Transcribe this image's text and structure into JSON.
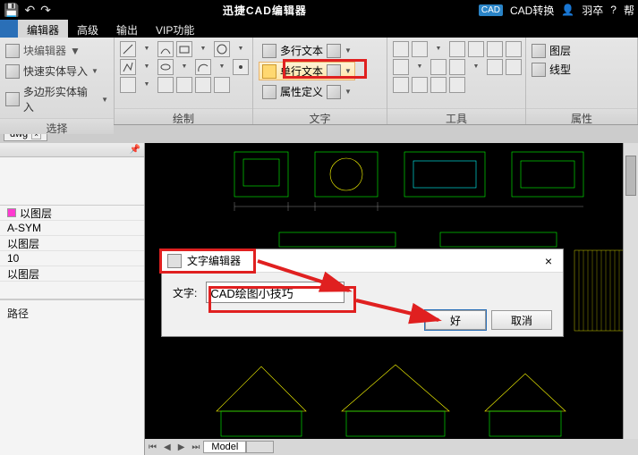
{
  "titlebar": {
    "title": "迅捷CAD编辑器",
    "cad_convert": "CAD转换",
    "user": "羽卒",
    "help": "帮"
  },
  "tabs": {
    "file_icon": "",
    "items": [
      "编辑器",
      "高级",
      "输出",
      "VIP功能"
    ]
  },
  "ribbon": {
    "select": {
      "label": "选择",
      "block_editor": "块编辑器",
      "item1": "快速实体导入",
      "item2": "多边形实体输入"
    },
    "draw": {
      "label": "绘制"
    },
    "text": {
      "label": "文字",
      "multi": "多行文本",
      "single": "单行文本",
      "attr": "属性定义"
    },
    "tools": {
      "label": "工具"
    },
    "props": {
      "label": "属性",
      "layer": "图层",
      "linetype": "线型"
    }
  },
  "doc_tab": "dwg",
  "panel": {
    "layers": [
      {
        "color": "#ff3ad0",
        "name": "以图层"
      },
      {
        "color": "",
        "name": "A-SYM"
      },
      {
        "color": "",
        "name": "以图层"
      },
      {
        "color": "",
        "name": "10"
      },
      {
        "color": "",
        "name": "以图层"
      }
    ],
    "path": "路径"
  },
  "canvas": {
    "model_tab": "Model"
  },
  "dialog": {
    "title": "文字编辑器",
    "field_label": "文字:",
    "field_value": "CAD绘图小技巧",
    "ok": "好",
    "cancel": "取消"
  }
}
